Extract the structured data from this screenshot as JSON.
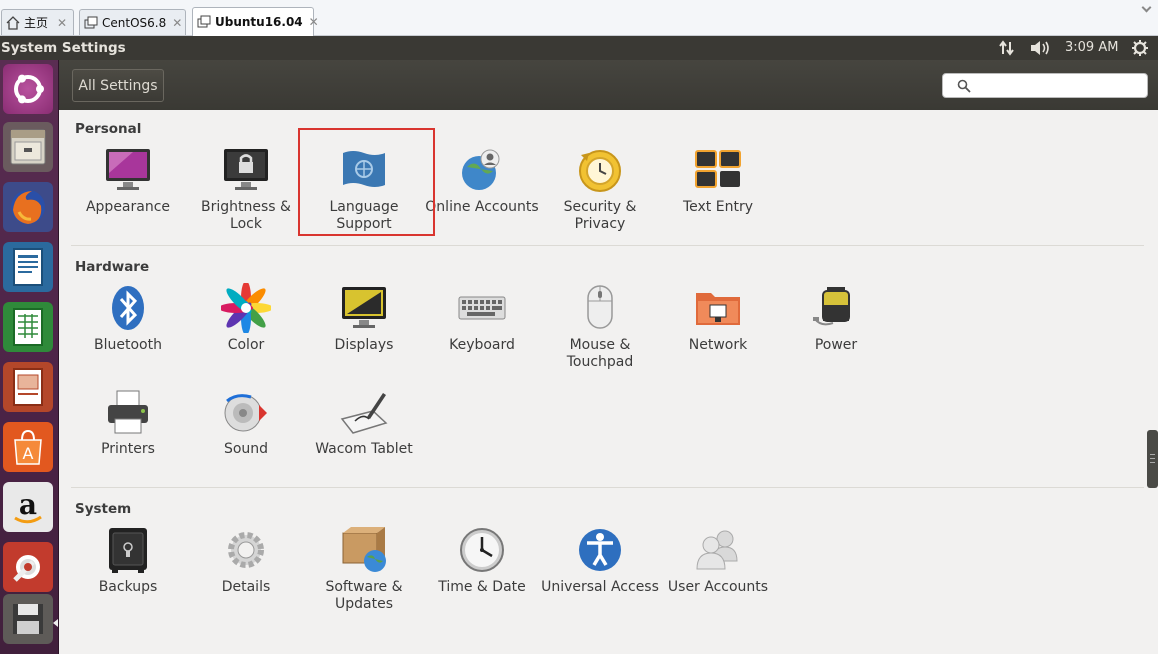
{
  "host_tabs": [
    {
      "label": "主页"
    },
    {
      "label": "CentOS6.8"
    },
    {
      "label": "Ubuntu16.04"
    }
  ],
  "top_panel": {
    "window_title": "System Settings",
    "time": "3:09 AM"
  },
  "header": {
    "all_settings_label": "All Settings",
    "search_placeholder": ""
  },
  "sections": {
    "personal": {
      "title": "Personal",
      "items": [
        "Appearance",
        "Brightness & Lock",
        "Language Support",
        "Online Accounts",
        "Security & Privacy",
        "Text Entry"
      ]
    },
    "hardware": {
      "title": "Hardware",
      "items": [
        "Bluetooth",
        "Color",
        "Displays",
        "Keyboard",
        "Mouse & Touchpad",
        "Network",
        "Power",
        "Printers",
        "Sound",
        "Wacom Tablet"
      ]
    },
    "system": {
      "title": "System",
      "items": [
        "Backups",
        "Details",
        "Software & Updates",
        "Time & Date",
        "Universal Access",
        "User Accounts"
      ]
    }
  },
  "launcher_icons": [
    "ubuntu-dash-icon",
    "files-icon",
    "firefox-icon",
    "writer-icon",
    "calc-icon",
    "impress-icon",
    "software-center-icon",
    "amazon-icon",
    "system-settings-icon",
    "floppy-icon"
  ],
  "colors": {
    "highlight": "#d9352f",
    "panel": "#3a3934",
    "launcher": "#4b2346"
  }
}
